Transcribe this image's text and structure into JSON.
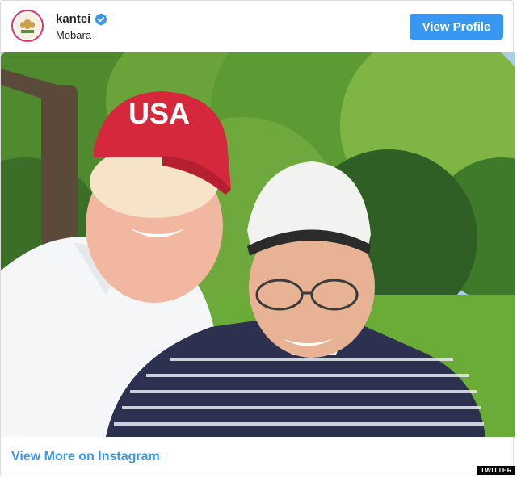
{
  "header": {
    "username": "kantei",
    "location": "Mobara",
    "view_profile_label": "View Profile",
    "verified_icon": "verified-badge-icon"
  },
  "footer": {
    "view_more_label": "View More on Instagram"
  },
  "photo": {
    "cap_text": "USA",
    "watermark": "TWITTER"
  },
  "colors": {
    "accent_blue": "#3897f0",
    "cap_red": "#d6283d"
  }
}
